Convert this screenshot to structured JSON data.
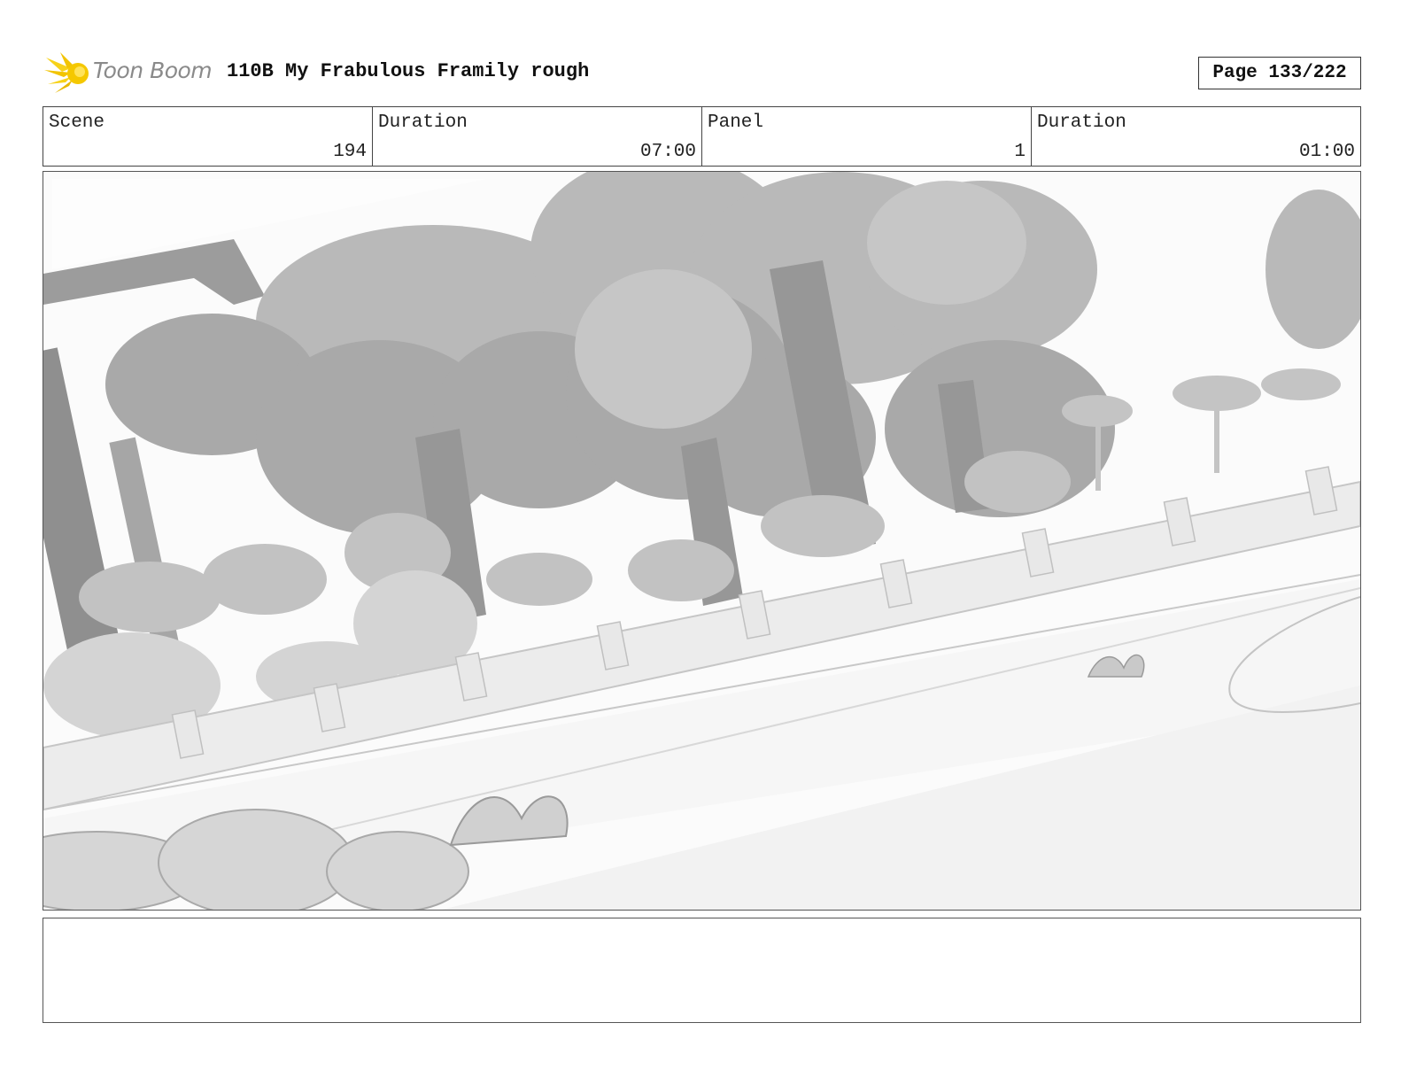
{
  "header": {
    "logo_text": "Toon Boom",
    "title": "110B My Frabulous Framily rough",
    "page": "Page 133/222",
    "colors": {
      "logo_star": "#f2c400",
      "logo_text": "#8a8a8a"
    }
  },
  "info": {
    "scene_label": "Scene",
    "scene_value": "194",
    "scene_duration_label": "Duration",
    "scene_duration_value": "07:00",
    "panel_label": "Panel",
    "panel_value": "1",
    "panel_duration_label": "Duration",
    "panel_duration_value": "01:00"
  },
  "panel": {
    "image": "grayscale-park-background-illustration"
  },
  "notes": {
    "text": ""
  }
}
